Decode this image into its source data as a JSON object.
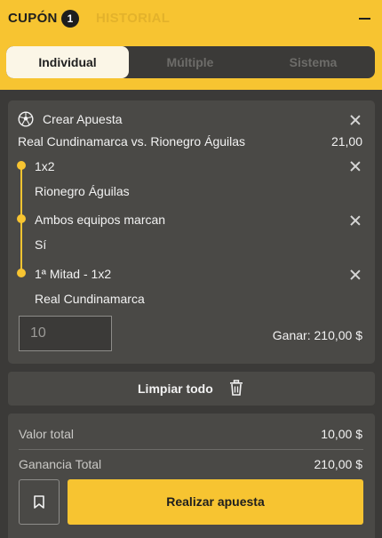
{
  "header": {
    "tab_cupon": "CUPÓN",
    "cupon_count": "1",
    "tab_historial": "HISTORIAL"
  },
  "bet_types": {
    "individual": "Individual",
    "multiple": "Múltiple",
    "sistema": "Sistema",
    "selected": "Individual"
  },
  "bet": {
    "title": "Crear Apuesta",
    "match": "Real Cundinamarca vs. Rionegro Águilas",
    "odds": "21,00",
    "legs": [
      {
        "market": "1x2",
        "selection": "Rionegro Águilas"
      },
      {
        "market": "Ambos equipos marcan",
        "selection": "Sí"
      },
      {
        "market": "1ª Mitad - 1x2",
        "selection": "Real Cundinamarca"
      }
    ],
    "stake_placeholder": "10",
    "win_label": "Ganar:",
    "win_value": "210,00 $"
  },
  "actions": {
    "clear_all": "Limpiar todo",
    "place_bet": "Realizar apuesta"
  },
  "summary": {
    "total_label": "Valor total",
    "total_value": "10,00 $",
    "profit_label": "Ganancia Total",
    "profit_value": "210,00 $"
  },
  "colors": {
    "accent": "#f7c431",
    "background": "#3b3a38",
    "card": "#4a4946"
  },
  "icons": [
    "soccer-ball-icon",
    "close-icon",
    "trash-icon",
    "bookmark-icon",
    "minimize-icon"
  ]
}
